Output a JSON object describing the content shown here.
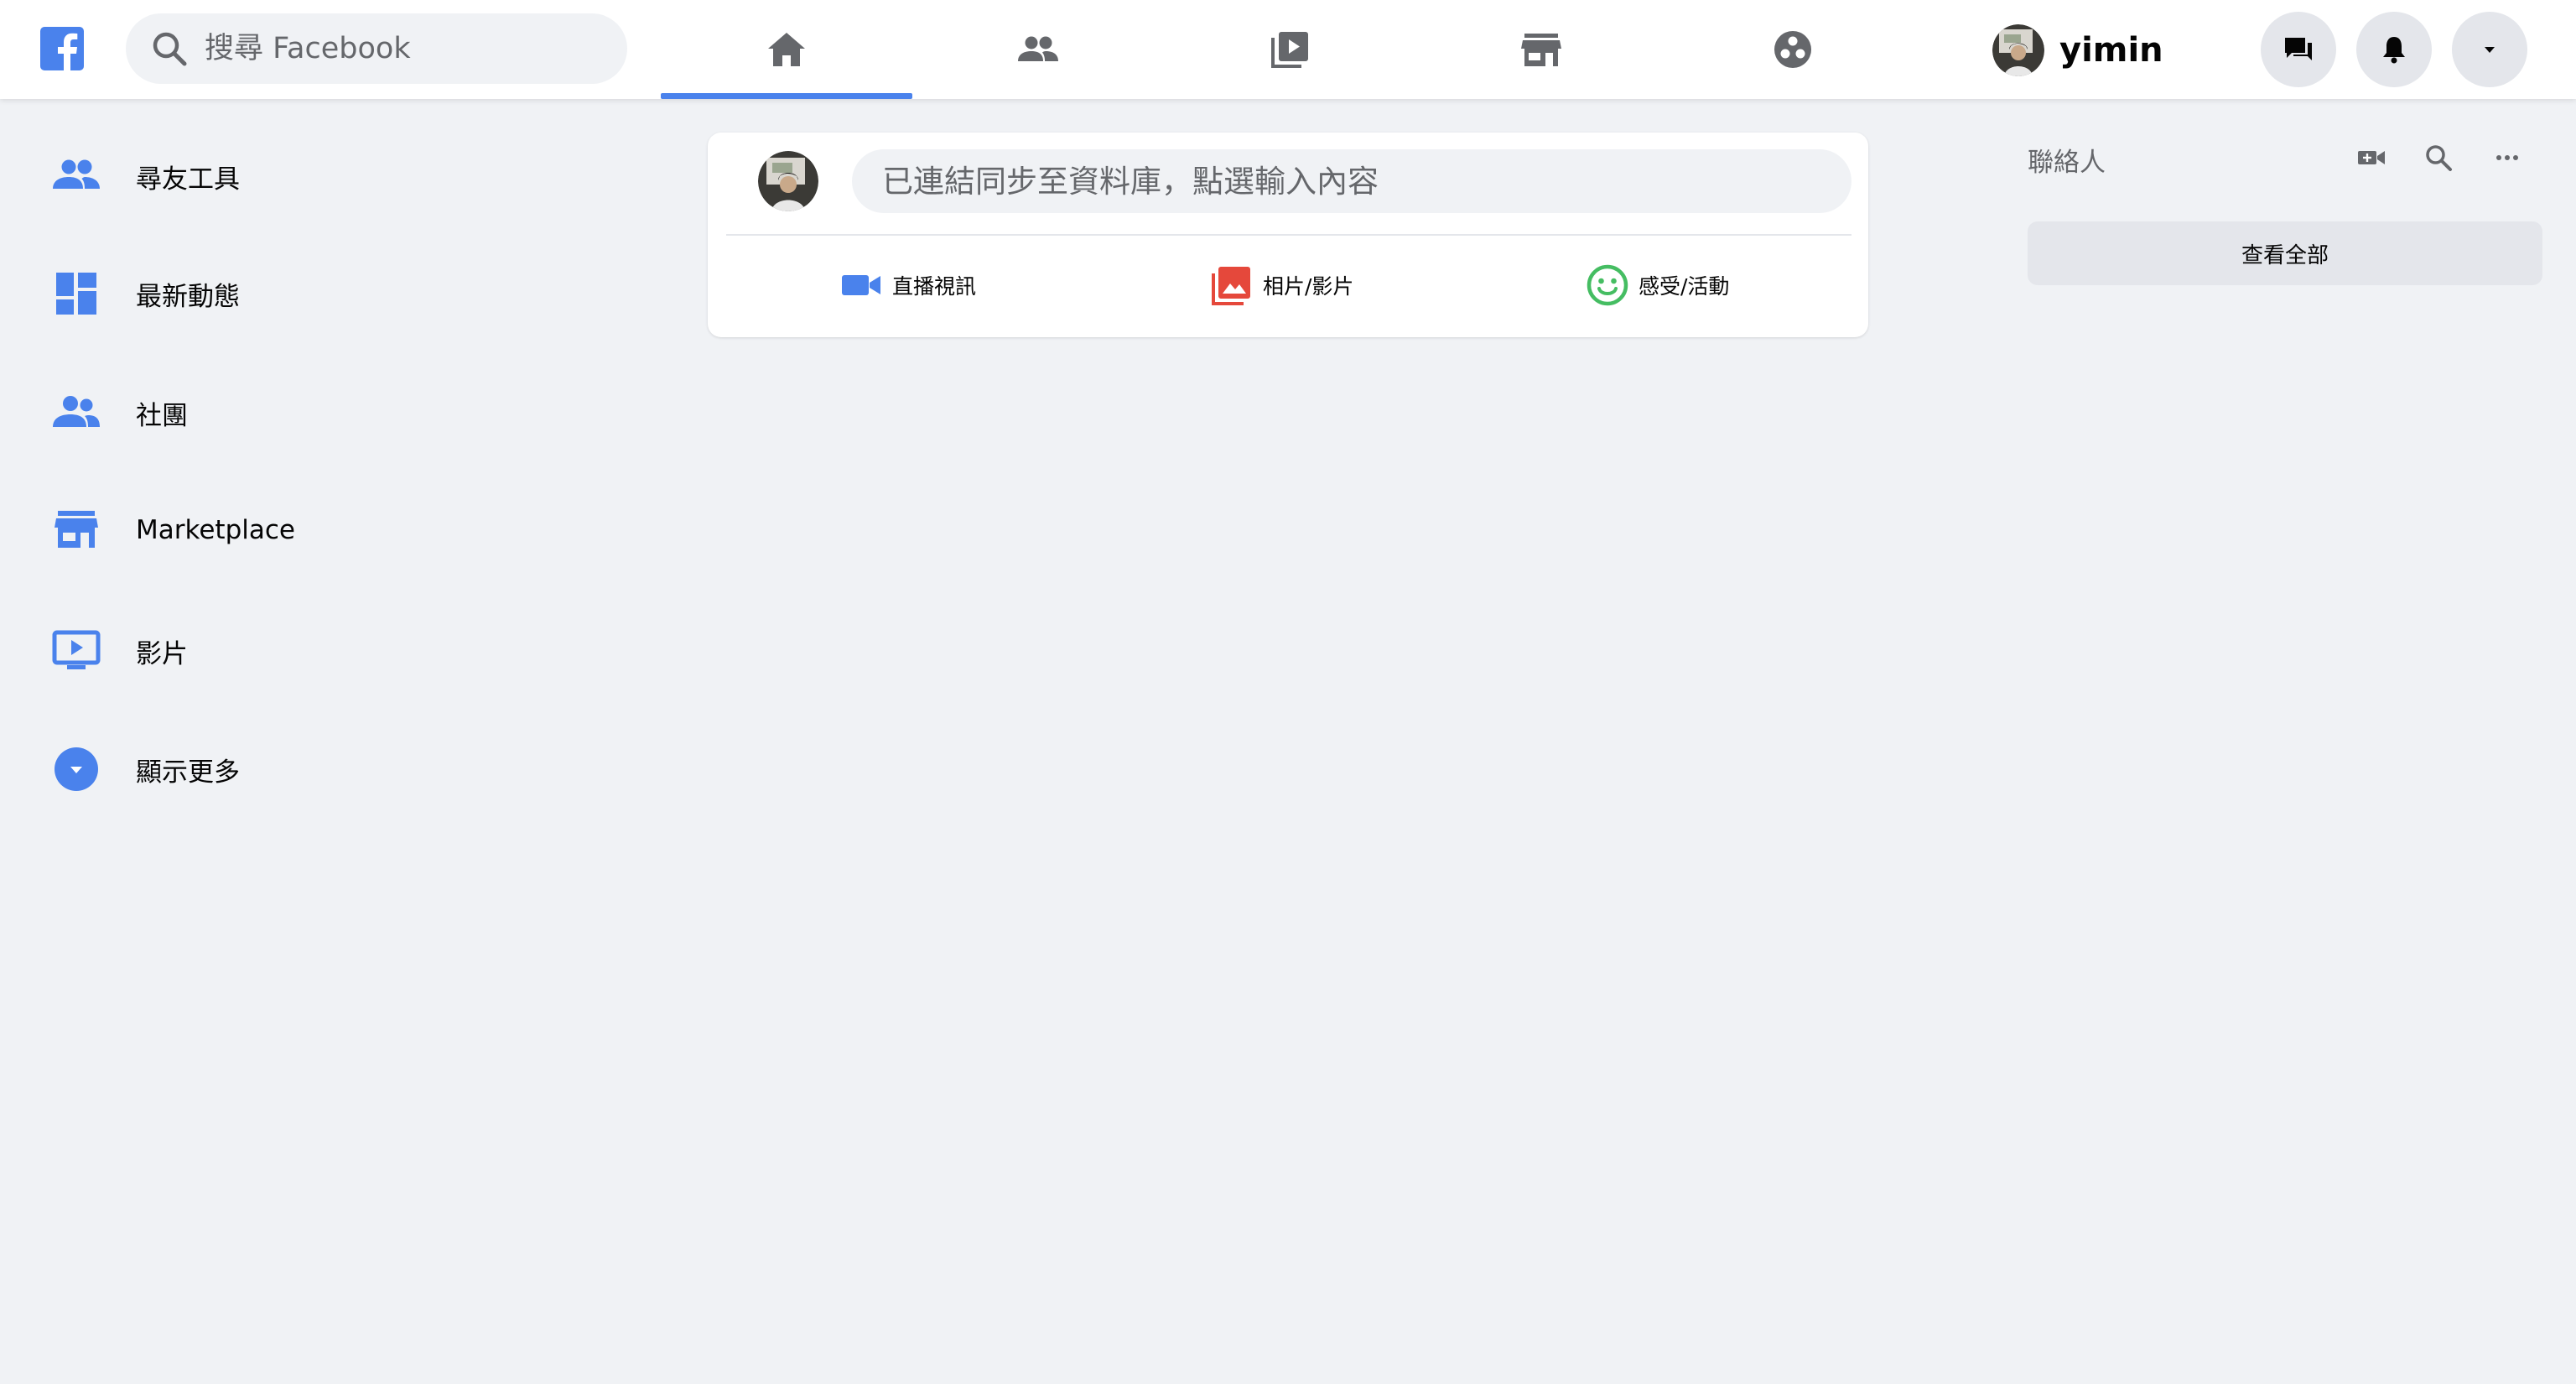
{
  "header": {
    "search_placeholder": "搜尋 Facebook",
    "nav_tabs": [
      {
        "name": "home",
        "active": true
      },
      {
        "name": "friends",
        "active": false
      },
      {
        "name": "watch",
        "active": false
      },
      {
        "name": "marketplace",
        "active": false
      },
      {
        "name": "groups",
        "active": false
      }
    ],
    "profile_name": "yimin",
    "accent_color": "#4a82ec"
  },
  "sidebar": {
    "items": [
      {
        "label": "尋友工具",
        "icon": "friends-icon"
      },
      {
        "label": "最新動態",
        "icon": "news-feed-icon"
      },
      {
        "label": "社團",
        "icon": "groups-icon"
      },
      {
        "label": "Marketplace",
        "icon": "marketplace-icon"
      },
      {
        "label": "影片",
        "icon": "video-icon"
      },
      {
        "label": "顯示更多",
        "icon": "chevron-down-icon"
      }
    ]
  },
  "composer": {
    "placeholder": "已連結同步至資料庫，點選輸入內容",
    "actions": [
      {
        "label": "直播視訊",
        "icon": "live-video-icon",
        "color": "#4a82ec"
      },
      {
        "label": "相片/影片",
        "icon": "photo-icon",
        "color": "#e5483b"
      },
      {
        "label": "感受/活動",
        "icon": "smiley-icon",
        "color": "#45bd62"
      }
    ]
  },
  "contacts": {
    "title": "聯絡人",
    "see_all_label": "查看全部"
  }
}
